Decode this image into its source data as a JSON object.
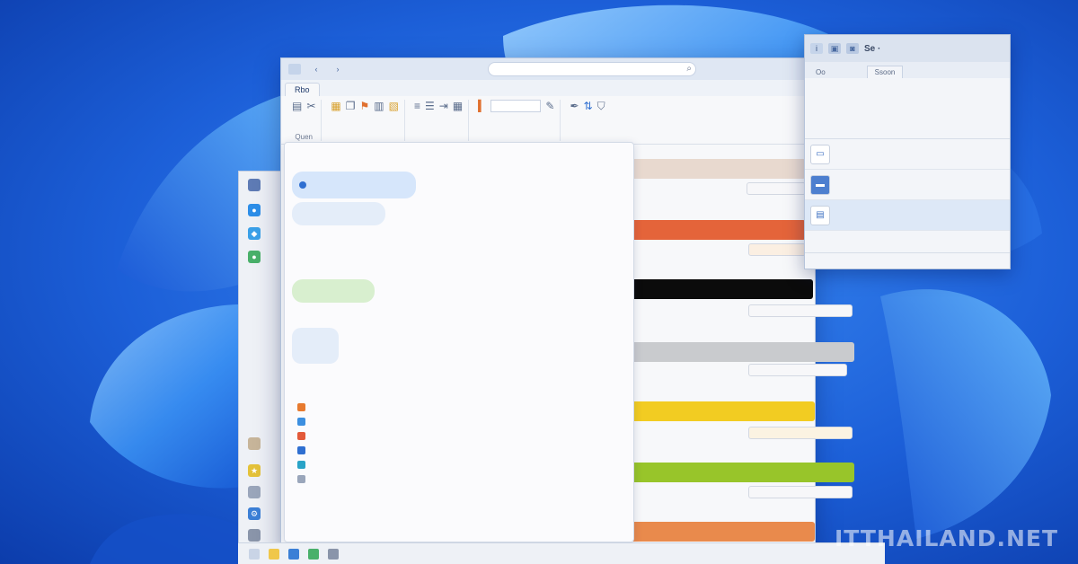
{
  "watermark": "ITTHAILAND.NET",
  "colors": {
    "wallpaper": "#1f5fd6",
    "accent": "#2f6fd1",
    "strip_tan": "#e8d9cf",
    "strip_orange": "#e4643a",
    "strip_black": "#0b0b0b",
    "strip_gray": "#c9cbce",
    "strip_yellow": "#f2cc22",
    "strip_green": "#98c52a",
    "strip_orange2": "#e98a4c"
  },
  "main_window": {
    "tabs": [
      "Rbo",
      "",
      "",
      ""
    ],
    "ribbon": {
      "group1_label": "Quen",
      "font_value": "",
      "group_labels": [
        "",
        "",
        "",
        "",
        ""
      ]
    }
  },
  "chat": {
    "header": "",
    "bubbles": [
      "",
      "",
      "",
      "",
      ""
    ],
    "list_items": [
      "",
      "",
      "",
      "",
      "",
      "",
      ""
    ]
  },
  "floating_window": {
    "title": "Se ·",
    "tabs": [
      "Oo",
      "",
      "",
      "Ssoon"
    ],
    "ribbon_items": [
      "",
      "",
      "",
      "",
      "",
      ""
    ],
    "rows": [
      {
        "title": "",
        "detail": ""
      },
      {
        "title": "",
        "detail": ""
      },
      {
        "title": "",
        "detail": ""
      }
    ],
    "status": ""
  },
  "icons": [
    "search-icon",
    "folder-icon",
    "chat-icon",
    "settings-icon",
    "image-icon",
    "document-icon"
  ]
}
